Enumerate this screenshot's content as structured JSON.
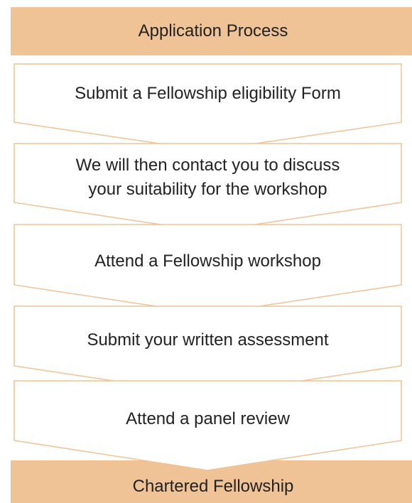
{
  "diagram": {
    "title": "Application Process",
    "outcome": "Chartered Fellowship",
    "steps": [
      {
        "lines": [
          "Submit a Fellowship eligibility Form"
        ]
      },
      {
        "lines": [
          "We will then contact you to discuss",
          "your suitability for the workshop"
        ]
      },
      {
        "lines": [
          "Attend a Fellowship workshop"
        ]
      },
      {
        "lines": [
          "Submit your written assessment"
        ]
      },
      {
        "lines": [
          "Attend a panel review"
        ]
      }
    ]
  },
  "colors": {
    "accent_fill": "#efc396",
    "chevron_stroke": "#efc396",
    "text": "#222222"
  }
}
